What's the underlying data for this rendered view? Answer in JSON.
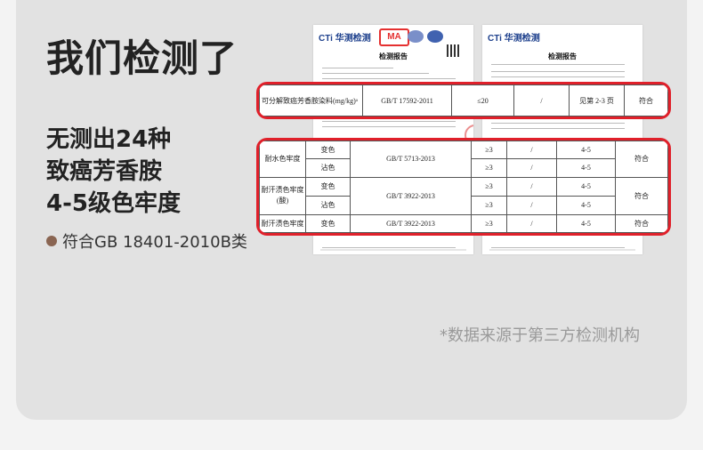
{
  "title": "我们检测了",
  "features": [
    "无测出24种",
    "致癌芳香胺",
    "4-5级色牢度"
  ],
  "standard": "符合GB 18401-2010B类",
  "source_note": "*数据来源于第三方检测机构",
  "documents": [
    {
      "logo": "CTi 华测检测",
      "ma": "MA",
      "doc_title": "检测报告"
    },
    {
      "logo": "CTi 华测检测",
      "doc_title": "检测报告"
    }
  ],
  "zoom1": {
    "item": "可分解致癌芳香胺染料(mg/kg)ᵃ",
    "method": "GB/T 17592-2011",
    "limit": "≤20",
    "result": "/",
    "see": "见第 2-3 页",
    "verdict": "符合"
  },
  "zoom2": {
    "rows": [
      {
        "item": "耐水色牢度",
        "sub": [
          "变色",
          "沾色"
        ],
        "method": "GB/T 5713-2013",
        "limit": [
          "≥3",
          "≥3"
        ],
        "result": [
          "/",
          "/"
        ],
        "grade": [
          "4-5",
          "4-5"
        ],
        "verdict": "符合"
      },
      {
        "item": "耐汗渍色牢度(酸)",
        "sub": [
          "变色",
          "沾色"
        ],
        "method": "GB/T 3922-2013",
        "limit": [
          "≥3",
          "≥3"
        ],
        "result": [
          "/",
          "/"
        ],
        "grade": [
          "4-5",
          "4-5"
        ],
        "verdict": "符合"
      },
      {
        "item": "耐汗渍色牢度",
        "sub": [
          "变色"
        ],
        "method": "GB/T 3922-2013",
        "limit": [
          "≥3"
        ],
        "result": [
          "/"
        ],
        "grade": [
          "4-5"
        ],
        "verdict": "符合"
      }
    ]
  },
  "colors": {
    "background": "#f3f3f3",
    "card": "#e2e2e2",
    "highlight": "#e0202a",
    "dot": "#8a6552"
  }
}
